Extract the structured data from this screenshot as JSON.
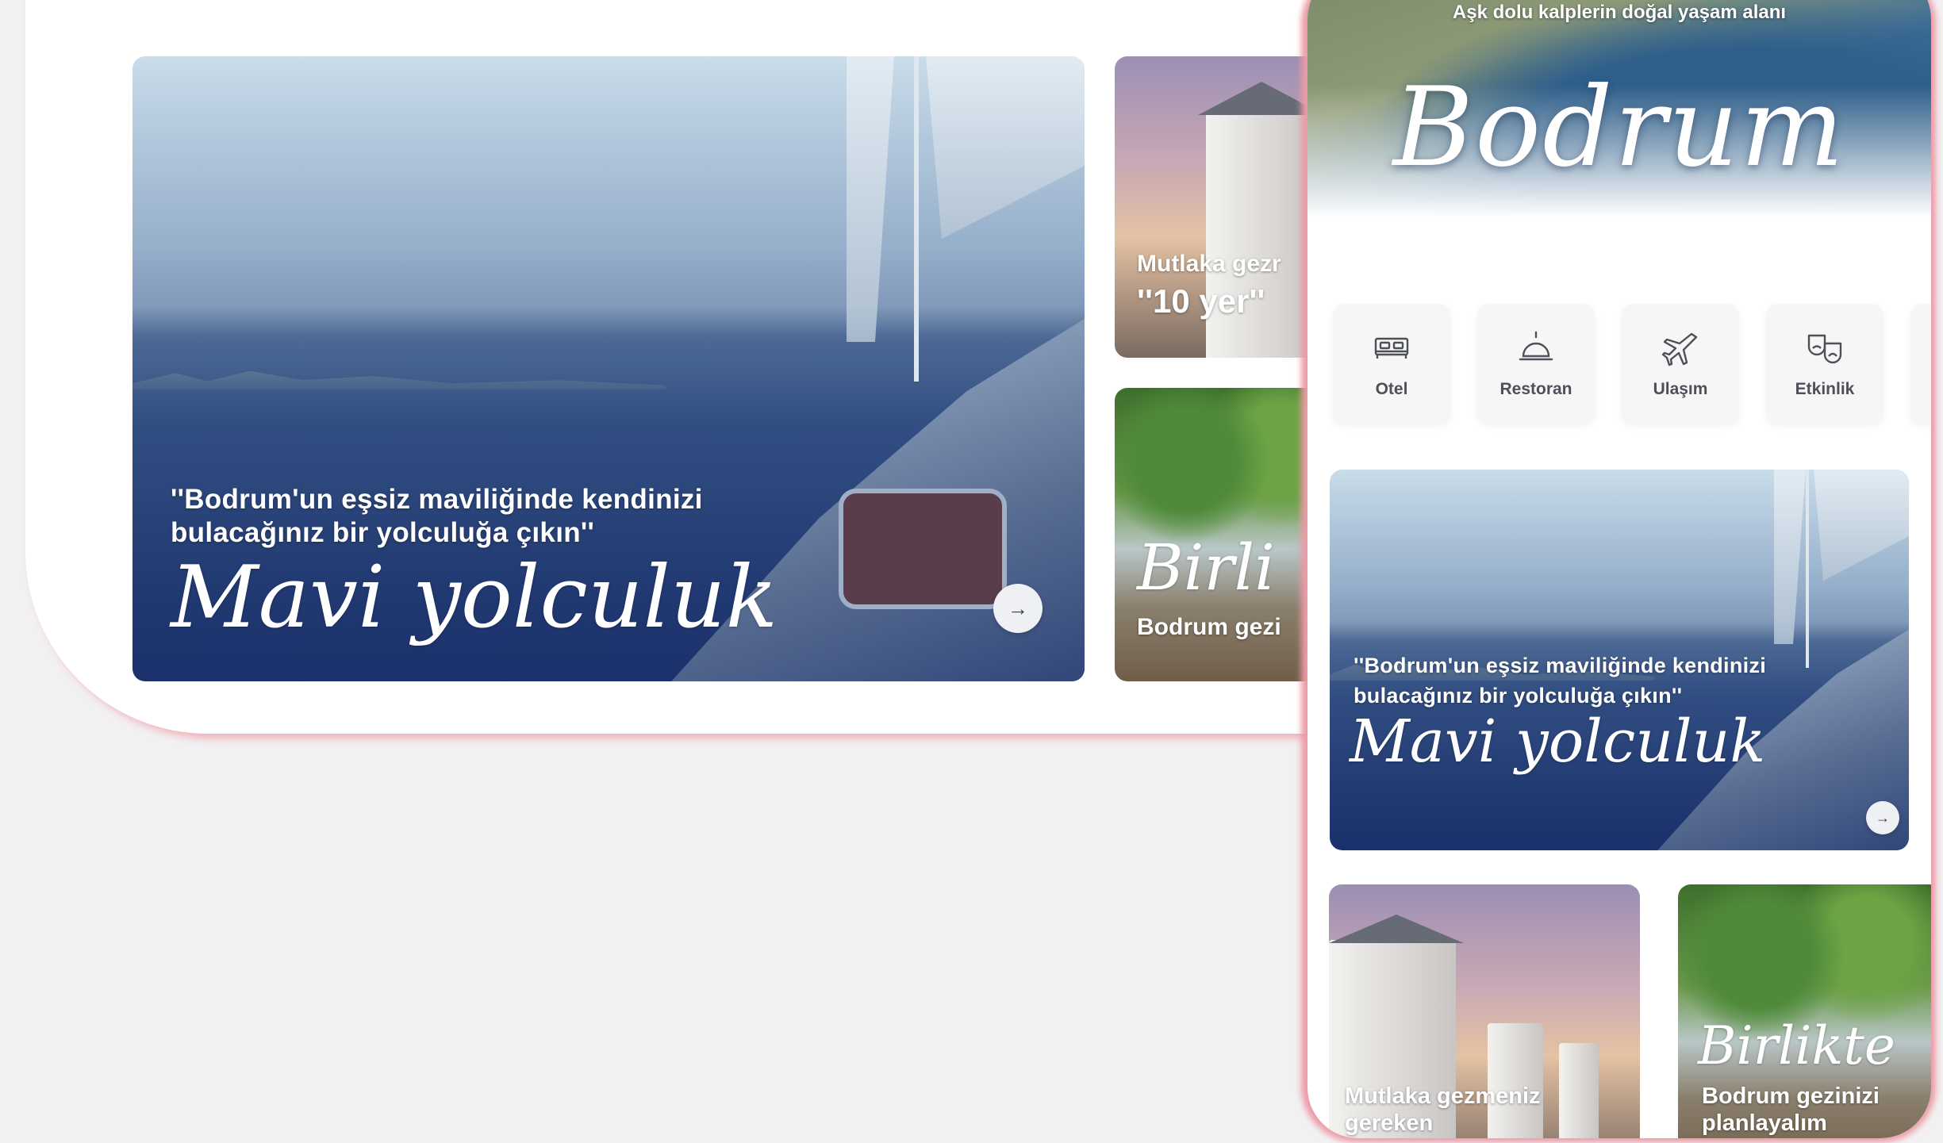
{
  "desktop": {
    "featured": {
      "quote": "''Bodrum'un eşsiz maviliğinde kendinizi bulacağınız bir yolculuğa çıkın''",
      "script_title": "Mavi yolculuk",
      "arrow_icon": "arrow-right-icon"
    },
    "side_cards": [
      {
        "line1": "Mutlaka gezr",
        "line2": "''10 yer''"
      },
      {
        "script": "Birli",
        "line": "Bodrum gezi"
      }
    ]
  },
  "phone": {
    "hero": {
      "subtitle": "Aşk dolu kalplerin doğal yaşam alanı",
      "title": "Bodrum"
    },
    "categories": [
      {
        "label": "Otel",
        "icon": "bed-icon"
      },
      {
        "label": "Restoran",
        "icon": "cloche-icon"
      },
      {
        "label": "Ulaşım",
        "icon": "airplane-icon"
      },
      {
        "label": "Etkinlik",
        "icon": "theater-masks-icon"
      }
    ],
    "featured": {
      "quote": "''Bodrum'un eşsiz maviliğinde kendinizi bulacağınız bir yolculuğa çıkın''",
      "script_title": "Mavi yolculuk"
    },
    "cards": [
      {
        "title": "Mutlaka gezmeniz gereken"
      },
      {
        "script": "Birlikte",
        "title": "Bodrum gezinizi planlayalım"
      }
    ]
  }
}
